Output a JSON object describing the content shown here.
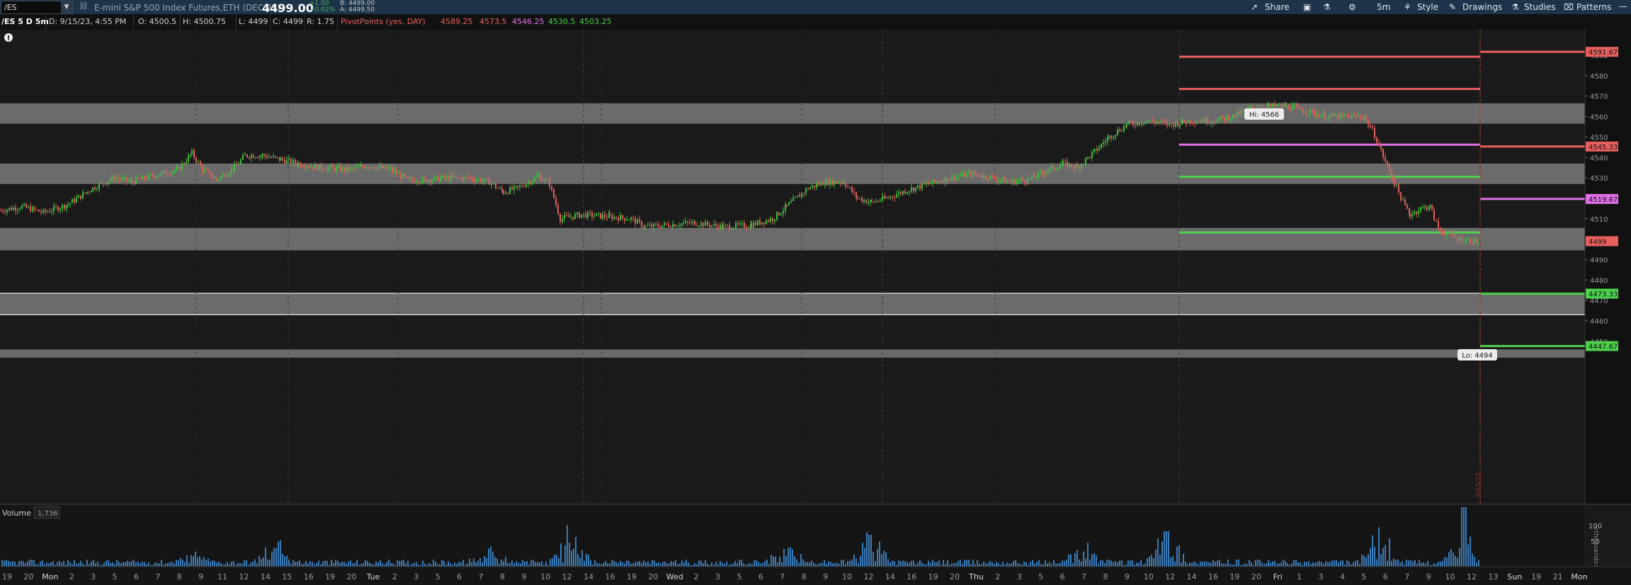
{
  "toolbar": {
    "symbol": "/ES",
    "description": "E-mini S&P 500 Index Futures,ETH (DEC 23)",
    "last_price": "4499.00",
    "change": "+1.00",
    "change_pct": "+0.02%",
    "bid": "B: 4499.00",
    "ask": "A: 4499.50",
    "share_label": "Share",
    "timeframe": "5m",
    "style_label": "Style",
    "drawings_label": "Drawings",
    "studies_label": "Studies",
    "patterns_label": "Patterns"
  },
  "infobar": {
    "title": "/ES 5 D 5m",
    "date": "D: 9/15/23, 4:55 PM",
    "open": "O: 4500.5",
    "high": "H: 4500.75",
    "low": "L: 4499",
    "close": "C: 4499",
    "range": "R: 1.75",
    "pivot_label": "PivotPoints (yes, DAY)",
    "pivot_values": [
      {
        "text": "4589.25",
        "color": "#e8605e"
      },
      {
        "text": "4573.5",
        "color": "#e8605e"
      },
      {
        "text": "4546.25",
        "color": "#e070e8"
      },
      {
        "text": "4530.5",
        "color": "#4cd04c"
      },
      {
        "text": "4503.25",
        "color": "#4cd04c"
      }
    ]
  },
  "chart_data": {
    "type": "candlestick",
    "y_ticks": [
      "4590",
      "4580",
      "4570",
      "4560",
      "4550",
      "4540",
      "4530",
      "4520",
      "4510",
      "4500",
      "4490",
      "4480",
      "4470",
      "4460",
      "4450"
    ],
    "price_labels": [
      {
        "text": "4591.67",
        "value": 4591.67,
        "color": "#e8605e"
      },
      {
        "text": "4545.33",
        "value": 4545.33,
        "color": "#e8605e"
      },
      {
        "text": "4519.67",
        "value": 4519.67,
        "color": "#e070e8"
      },
      {
        "text": "4499",
        "value": 4499,
        "color": "#e8605e"
      },
      {
        "text": "4473.33",
        "value": 4473.33,
        "color": "#4cd04c"
      },
      {
        "text": "4447.67",
        "value": 4447.67,
        "color": "#4cd04c"
      }
    ],
    "hi_label": "Hi: 4566",
    "lo_label": "Lo: 4494",
    "cursor_date": "9/15/23",
    "x_ticks": [
      "19",
      "20",
      "Mon",
      "2",
      "3",
      "5",
      "6",
      "7",
      "8",
      "9",
      "11",
      "12",
      "14",
      "15",
      "16",
      "19",
      "20",
      "Tue",
      "2",
      "3",
      "5",
      "6",
      "7",
      "8",
      "9",
      "10",
      "12",
      "14",
      "16",
      "19",
      "20",
      "Wed",
      "2",
      "3",
      "5",
      "6",
      "7",
      "8",
      "9",
      "10",
      "12",
      "14",
      "16",
      "19",
      "20",
      "Thu",
      "2",
      "3",
      "5",
      "6",
      "7",
      "8",
      "9",
      "10",
      "12",
      "14",
      "16",
      "19",
      "20",
      "Fri",
      "1",
      "3",
      "4",
      "5",
      "6",
      "7",
      "9",
      "10",
      "12",
      "13",
      "Sun",
      "19",
      "21",
      "Mon"
    ],
    "shaded_zones": [
      [
        4556.5,
        4566.5
      ],
      [
        4527,
        4537
      ],
      [
        4494.5,
        4505.5
      ],
      [
        4463,
        4473.5
      ],
      [
        4442,
        4446
      ]
    ],
    "volume_label": "Volume",
    "volume_value": "1,736",
    "volume_ticks": [
      "100",
      "50"
    ],
    "volume_axis_label": "<thousands>"
  }
}
